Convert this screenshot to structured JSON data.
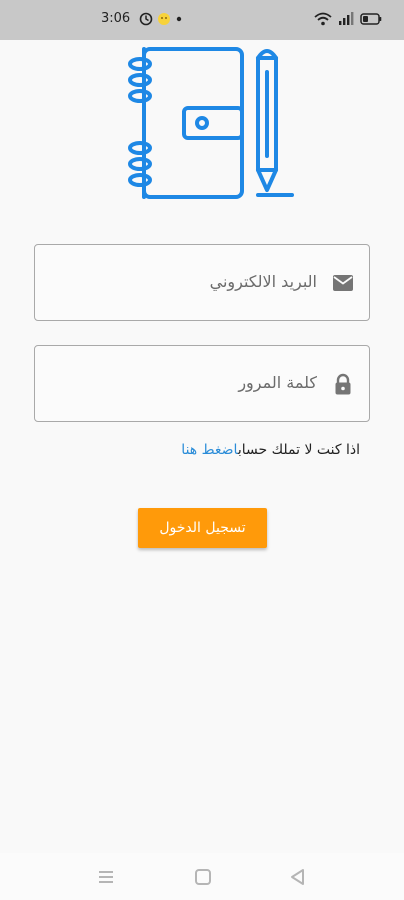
{
  "status_bar": {
    "time": "3:06",
    "icons": [
      "sync-icon",
      "emoji-icon",
      "dot-icon",
      "wifi-icon",
      "signal-icon",
      "battery-icon"
    ]
  },
  "logo": {
    "icon": "notebook-pen-icon",
    "color": "#1e88e5"
  },
  "form": {
    "email": {
      "placeholder": "البريد الالكتروني",
      "icon": "envelope-icon"
    },
    "password": {
      "placeholder": "كلمة المرور",
      "icon": "lock-icon"
    },
    "signup_prompt": "اذا كنت لا تملك حساب",
    "signup_link": "اضغط هنا",
    "login_label": "تسجيل الدخول"
  },
  "nav_bar": {
    "icons": [
      "menu-icon",
      "home-square-icon",
      "back-triangle-icon"
    ]
  },
  "colors": {
    "accent": "#ff9a0a",
    "link": "#2a8cd8",
    "logo": "#1e88e5"
  }
}
